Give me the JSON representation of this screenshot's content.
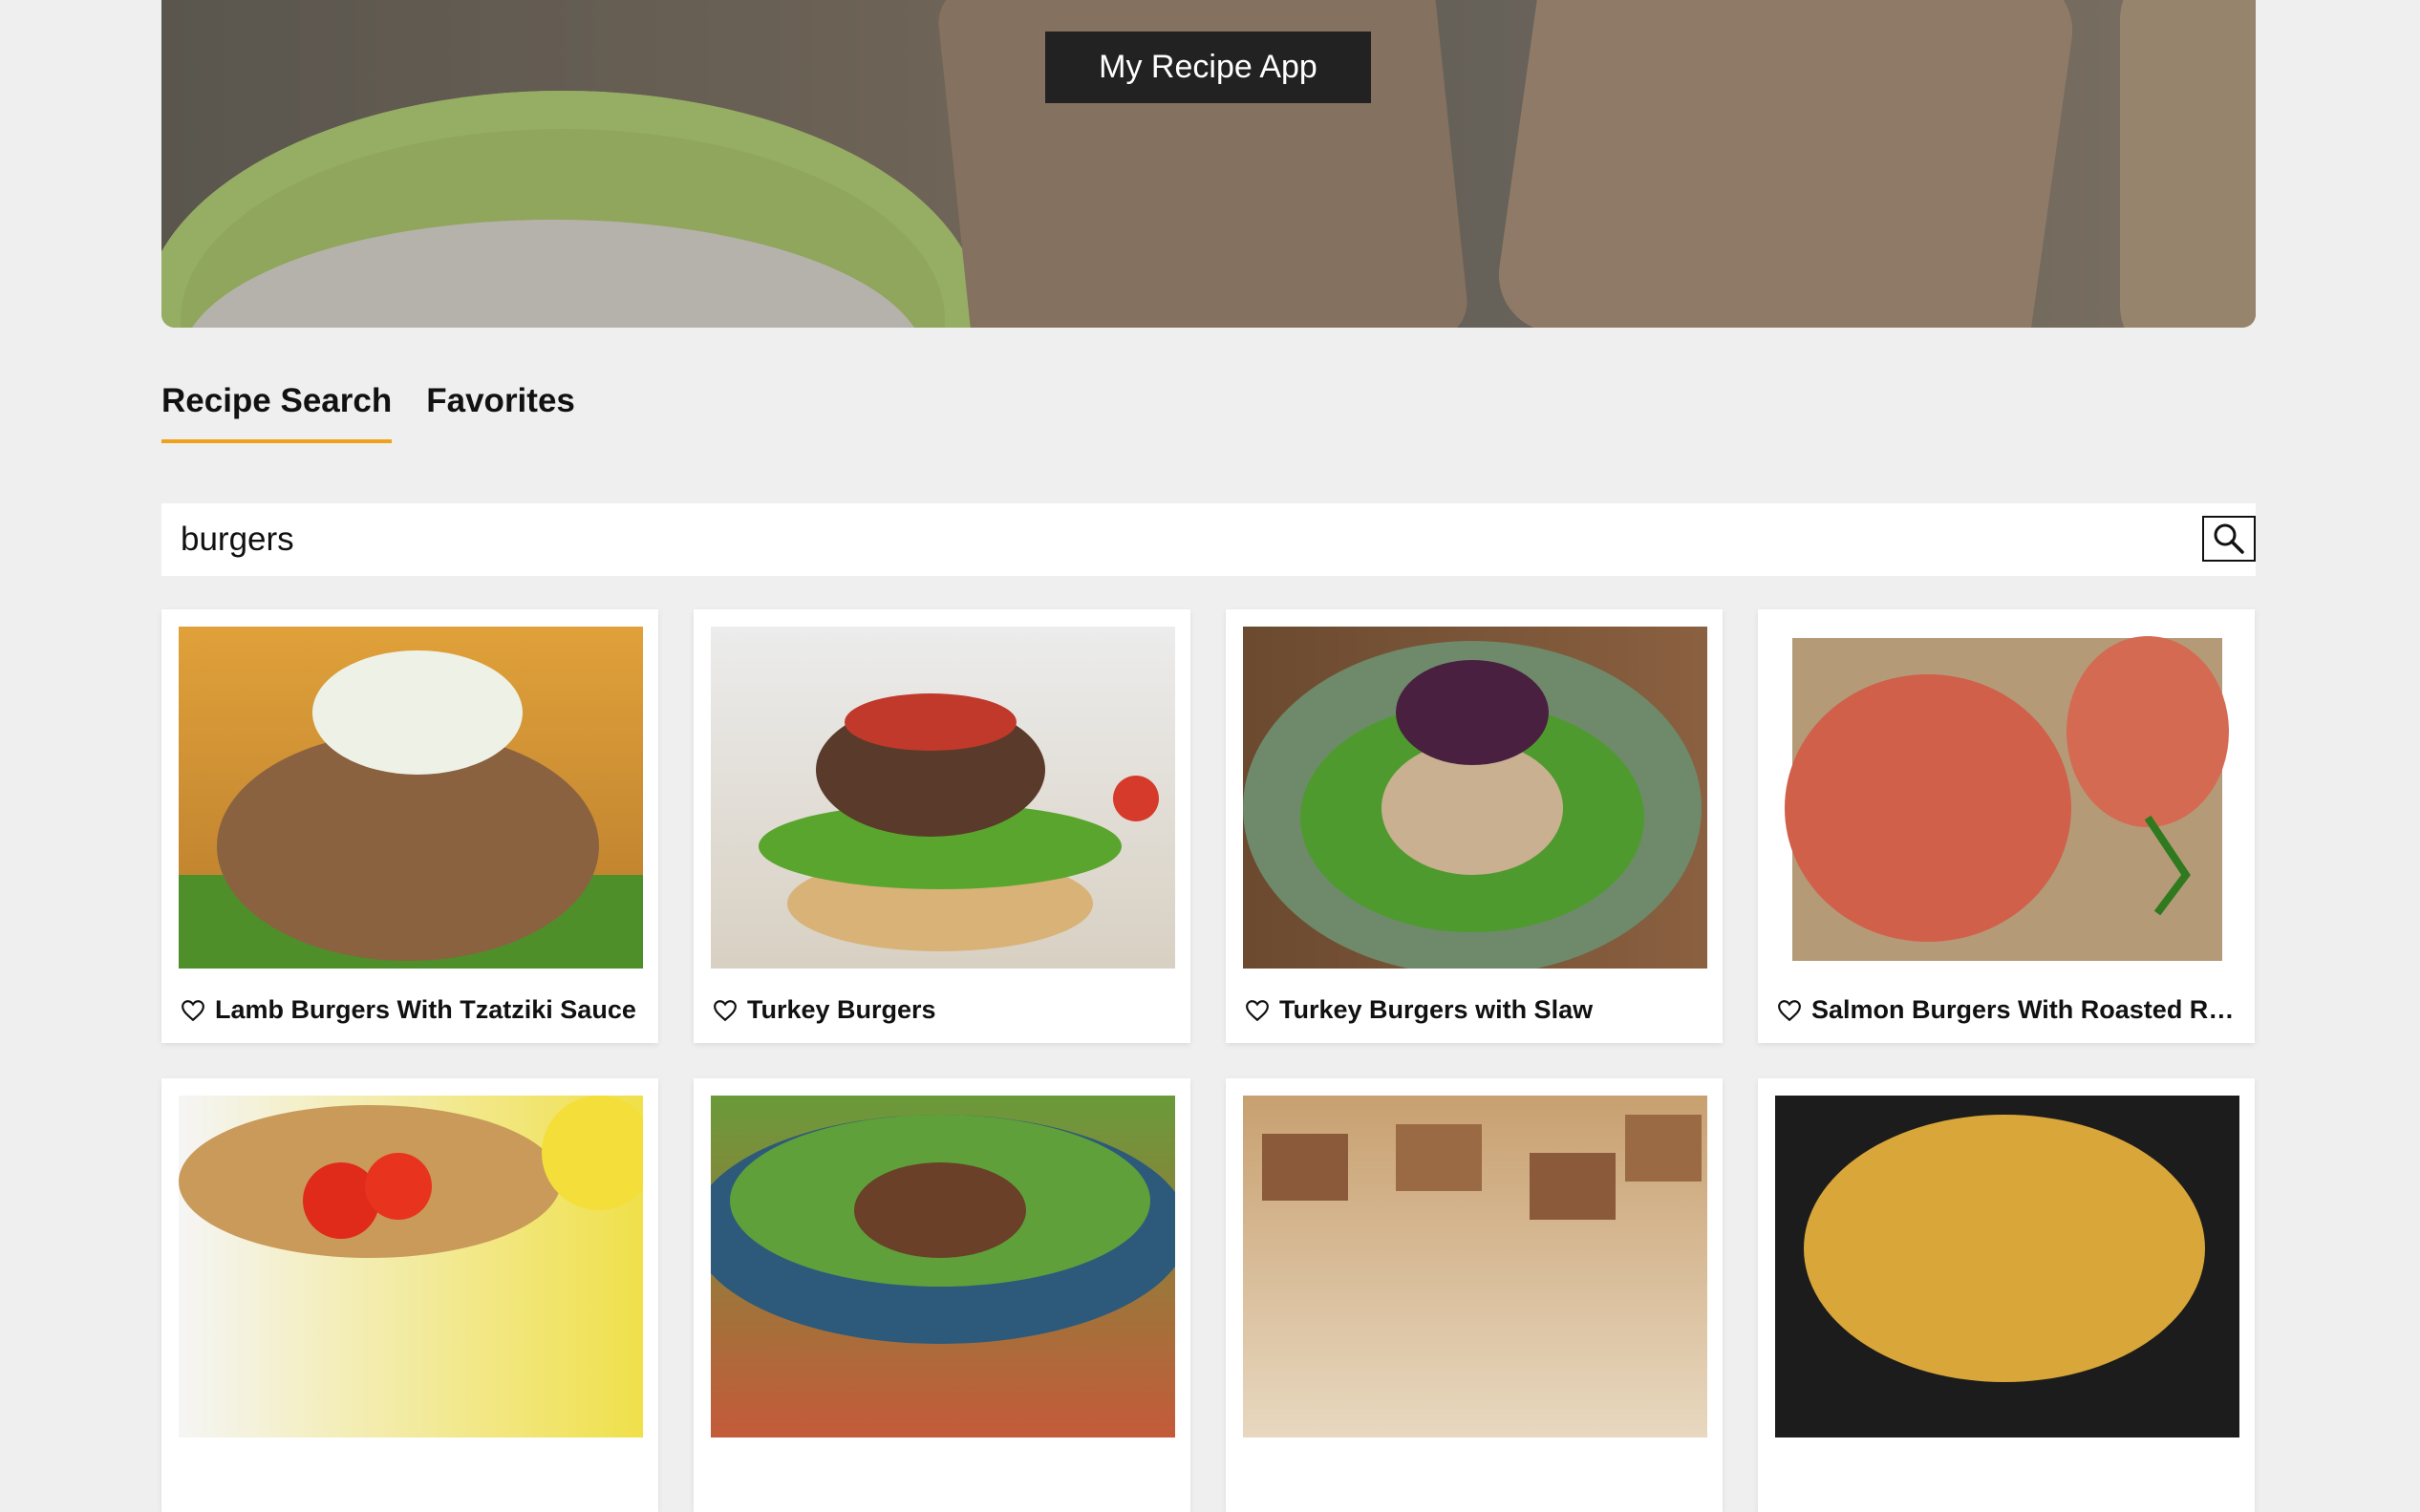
{
  "header": {
    "app_title": "My Recipe App"
  },
  "tabs": [
    {
      "label": "Recipe Search",
      "active": true
    },
    {
      "label": "Favorites",
      "active": false
    }
  ],
  "search": {
    "value": "burgers",
    "icon": "search-icon"
  },
  "accent_color": "#f0a11a",
  "recipes": [
    {
      "title": "Lamb Burgers With Tzatziki Sauce"
    },
    {
      "title": "Turkey Burgers"
    },
    {
      "title": "Turkey Burgers with Slaw"
    },
    {
      "title": "Salmon Burgers With Roasted Re..."
    }
  ]
}
